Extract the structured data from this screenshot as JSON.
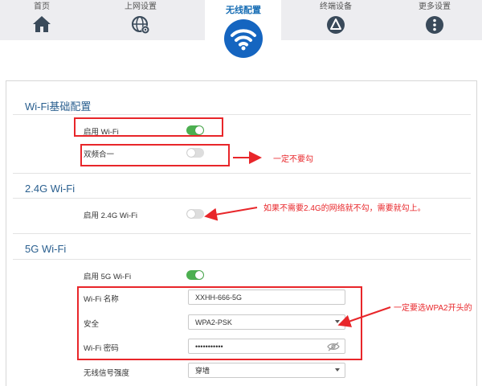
{
  "nav": {
    "home": "首页",
    "internet": "上网设置",
    "wireless": "无线配置",
    "devices": "终端设备",
    "more": "更多设置"
  },
  "basic": {
    "title": "Wi-Fi基础配置",
    "enable_wifi": "启用 Wi-Fi",
    "dual_band": "双频合一"
  },
  "band24": {
    "title": "2.4G Wi-Fi",
    "enable": "启用 2.4G Wi-Fi"
  },
  "band5": {
    "title": "5G Wi-Fi",
    "enable": "启用 5G Wi-Fi",
    "name_label": "Wi-Fi 名称",
    "name_value": "XXHH-666-5G",
    "security_label": "安全",
    "security_value": "WPA2-PSK",
    "password_label": "Wi-Fi 密码",
    "password_value": "•••••••••••",
    "signal_label": "无线信号强度",
    "signal_value": "穿墙"
  },
  "annotations": {
    "dual_band_note": "一定不要勾",
    "band24_note": "如果不需要2.4G的网络就不勾，需要就勾上。",
    "security_note": "一定要选WPA2开头的"
  },
  "colors": {
    "accent": "#1565c0",
    "toggle_on": "#4caf50",
    "annotation": "#e8262a"
  },
  "toggles": {
    "enable_wifi": true,
    "dual_band": false,
    "band24": false,
    "band5": true
  }
}
